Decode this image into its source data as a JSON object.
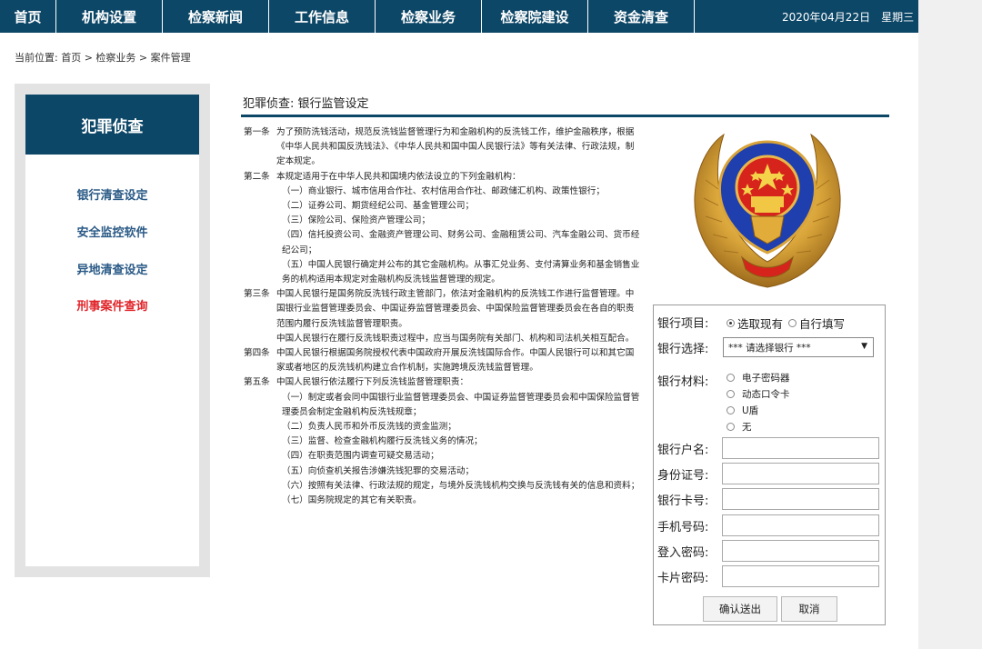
{
  "nav": {
    "items": [
      "首页",
      "机构设置",
      "检察新闻",
      "工作信息",
      "检察业务",
      "检察院建设",
      "资金清查"
    ],
    "date": "2020年04月22日",
    "weekday": "星期三"
  },
  "breadcrumb": "当前位置: 首页 > 检察业务 > 案件管理",
  "sidebar": {
    "title": "犯罪侦查",
    "items": [
      "银行清查设定",
      "安全监控软件",
      "异地清查设定",
      "刑事案件查询"
    ]
  },
  "main": {
    "title": "犯罪侦查: 银行监管设定",
    "articles": [
      {
        "head": "第一条",
        "body": "为了预防洗钱活动，规范反洗钱监督管理行为和金融机构的反洗钱工作，维护金融秩序，根据《中华人民共和国反洗钱法》、《中华人民共和国中国人民银行法》等有关法律、行政法规，制定本规定。",
        "subs": []
      },
      {
        "head": "第二条",
        "body": "本规定适用于在中华人民共和国境内依法设立的下列金融机构：",
        "subs": [
          "（一）商业银行、城市信用合作社、农村信用合作社、邮政储汇机构、政策性银行；",
          "（二）证券公司、期货经纪公司、基金管理公司；",
          "（三）保险公司、保险资产管理公司；",
          "（四）信托投资公司、金融资产管理公司、财务公司、金融租赁公司、汽车金融公司、货币经纪公司；",
          "（五）中国人民银行确定并公布的其它金融机构。从事汇兑业务、支付清算业务和基金销售业务的机构适用本规定对金融机构反洗钱监督管理的规定。"
        ]
      },
      {
        "head": "第三条",
        "body": "中国人民银行是国务院反洗钱行政主管部门，依法对金融机构的反洗钱工作进行监督管理。中国银行业监督管理委员会、中国证券监督管理委员会、中国保险监督管理委员会在各自的职责范围内履行反洗钱监督管理职责。",
        "body2": "中国人民银行在履行反洗钱职责过程中，应当与国务院有关部门、机构和司法机关相互配合。",
        "subs": []
      },
      {
        "head": "第四条",
        "body": "中国人民银行根据国务院授权代表中国政府开展反洗钱国际合作。中国人民银行可以和其它国家或者地区的反洗钱机构建立合作机制，实施跨境反洗钱监督管理。",
        "subs": []
      },
      {
        "head": "第五条",
        "body": "中国人民银行依法履行下列反洗钱监督管理职责：",
        "subs": [
          "（一）制定或者会同中国银行业监督管理委员会、中国证券监督管理委员会和中国保险监督管理委员会制定金融机构反洗钱规章；",
          "（二）负责人民币和外币反洗钱的资金监测；",
          "（三）监督、检查金融机构履行反洗钱义务的情况；",
          "（四）在职责范围内调查可疑交易活动；",
          "（五）向侦查机关报告涉嫌洗钱犯罪的交易活动；",
          "（六）按照有关法律、行政法规的规定，与境外反洗钱机构交换与反洗钱有关的信息和资料；",
          "（七）国务院规定的其它有关职责。"
        ]
      }
    ]
  },
  "form": {
    "bank_project_label": "银行项目:",
    "bank_project_options": [
      "选取现有",
      "自行填写"
    ],
    "bank_select_label": "银行选择:",
    "bank_select_value": "*** 请选择银行 ***",
    "material_label": "银行材料:",
    "material_options": [
      "电子密码器",
      "动态口令卡",
      "U盾",
      "无"
    ],
    "fields": [
      "银行户名:",
      "身份证号:",
      "银行卡号:",
      "手机号码:",
      "登入密码:",
      "卡片密码:"
    ],
    "submit_label": "确认送出",
    "cancel_label": "取消"
  }
}
